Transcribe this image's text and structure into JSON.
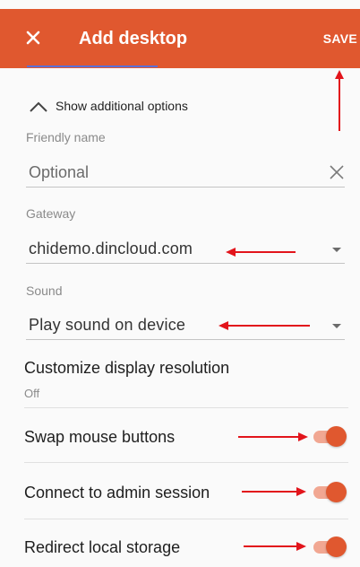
{
  "appbar": {
    "title": "Add desktop",
    "save_label": "SAVE",
    "close_icon": "close-icon",
    "background_color": "#e0582f"
  },
  "options": {
    "toggle_label": "Show additional options",
    "toggle_icon": "chevron-up-icon"
  },
  "friendly_name": {
    "label": "Friendly name",
    "placeholder": "Optional",
    "value": "",
    "clear_icon": "close-icon"
  },
  "gateway": {
    "label": "Gateway",
    "selected": "chidemo.dincloud.com",
    "dropdown_icon": "caret-down-icon"
  },
  "sound": {
    "label": "Sound",
    "selected": "Play sound on device",
    "dropdown_icon": "caret-down-icon"
  },
  "display_resolution": {
    "label": "Customize display resolution",
    "value": "Off"
  },
  "toggles": [
    {
      "label": "Swap mouse buttons",
      "on": true
    },
    {
      "label": "Connect to admin session",
      "on": true
    },
    {
      "label": "Redirect local storage",
      "on": true
    }
  ],
  "annotation_color": "#e2141b",
  "accent_color": "#e0582f"
}
